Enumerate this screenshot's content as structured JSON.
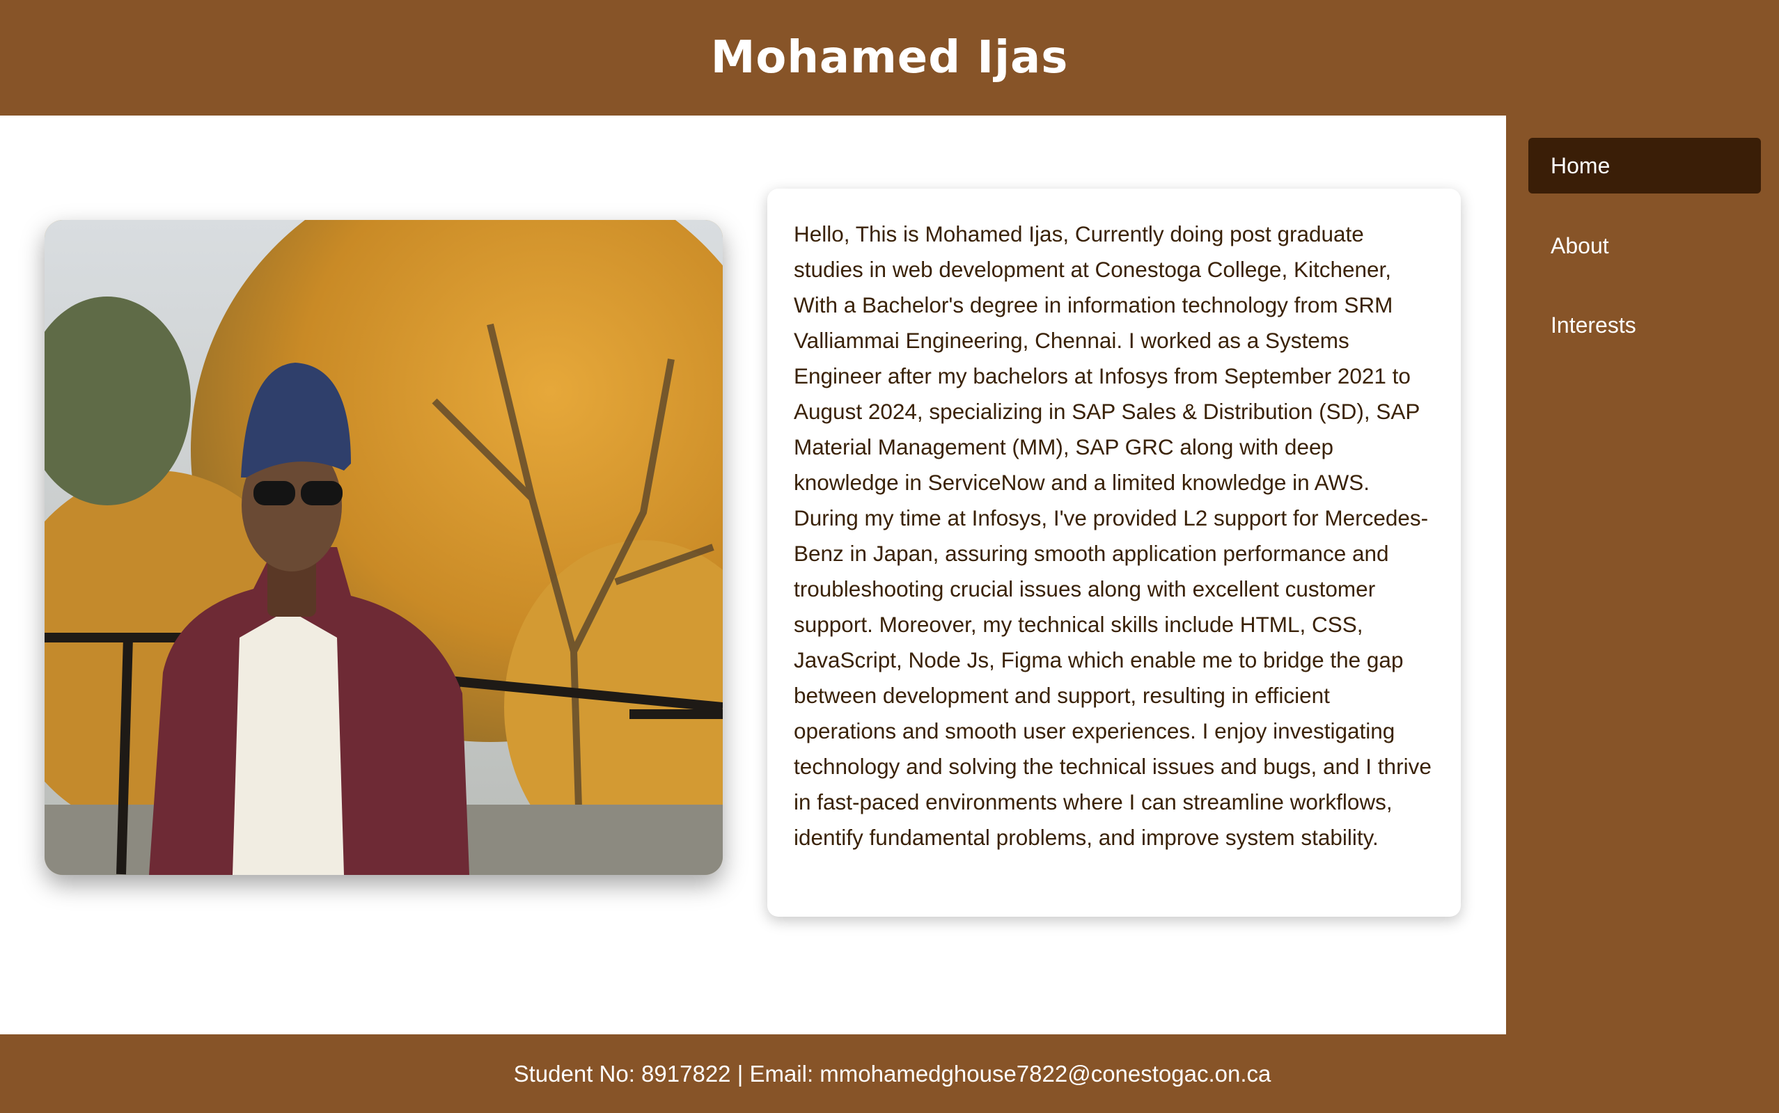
{
  "header": {
    "title": "Mohamed Ijas"
  },
  "nav": {
    "items": [
      {
        "label": "Home",
        "active": true
      },
      {
        "label": "About",
        "active": false
      },
      {
        "label": "Interests",
        "active": false
      }
    ]
  },
  "main": {
    "photo_alt": "Mohamed Ijas",
    "about_text": "Hello, This is Mohamed Ijas, Currently doing post graduate studies in web development at Conestoga College, Kitchener, With a Bachelor's degree in information technology from SRM Valliammai Engineering, Chennai. I worked as a Systems Engineer after my bachelors at Infosys from September 2021 to August 2024, specializing in SAP Sales & Distribution (SD), SAP Material Management (MM), SAP GRC along with deep knowledge in ServiceNow and a limited knowledge in AWS. During my time at Infosys, I've provided L2 support for Mercedes-Benz in Japan, assuring smooth application performance and troubleshooting crucial issues along with excellent customer support. Moreover, my technical skills include HTML, CSS, JavaScript, Node Js, Figma which enable me to bridge the gap between development and support, resulting in efficient operations and smooth user experiences. I enjoy investigating technology and solving the technical issues and bugs, and I thrive in fast-paced environments where I can streamline workflows, identify fundamental problems, and improve system stability."
  },
  "footer": {
    "text": "Student No: 8917822 | Email: mmohamedghouse7822@conestogac.on.ca"
  },
  "colors": {
    "brand_brown": "#875428",
    "nav_active": "#3a1e07",
    "body_text": "#3a2208",
    "white": "#ffffff"
  }
}
